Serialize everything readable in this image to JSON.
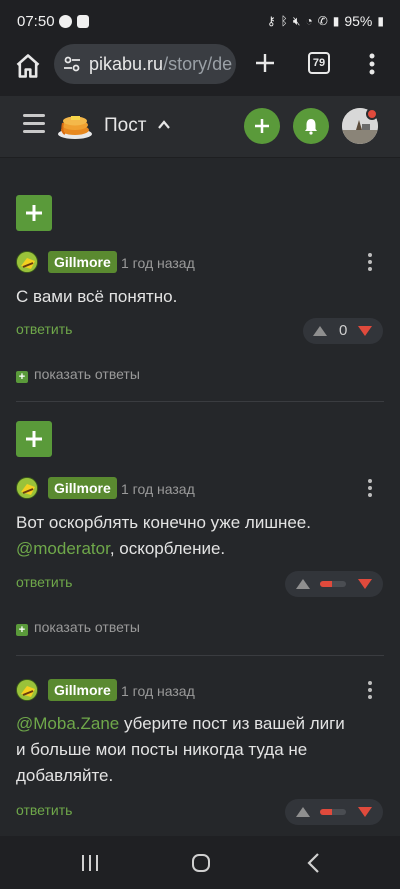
{
  "status": {
    "time": "07:50",
    "battery": "95%"
  },
  "browser": {
    "url_main": "pikabu.ru",
    "url_rest": "/story/de",
    "tabs_count": "79"
  },
  "header": {
    "title": "Пост"
  },
  "comments": [
    {
      "user": "Gillmore",
      "time": "1 год назад",
      "text_before": "С вами всё понятно.",
      "mention": "",
      "text_after": "",
      "reply": "ответить",
      "rating": "0",
      "rating_negative_fraction": 0,
      "show_replies": "показать ответы"
    },
    {
      "user": "Gillmore",
      "time": "1 год назад",
      "text_before": "Вот оскорблять конечно уже лишнее. ",
      "mention": "@moderator",
      "text_after": ", оскорбление.",
      "reply": "ответить",
      "rating": "",
      "rating_negative_fraction": 0.45,
      "show_replies": "показать ответы"
    },
    {
      "user": "Gillmore",
      "time": "1 год назад",
      "text_before": "",
      "mention": "@Moba.Zane",
      "text_after": " уберите пост из вашей лиги и больше мои посты никогда туда не добавляйте.",
      "reply": "ответить",
      "rating": "",
      "rating_negative_fraction": 0.45,
      "show_replies": ""
    }
  ],
  "colors": {
    "accent_green": "#5a9a3a",
    "downvote_red": "#e04a3c",
    "background": "#25272a"
  }
}
